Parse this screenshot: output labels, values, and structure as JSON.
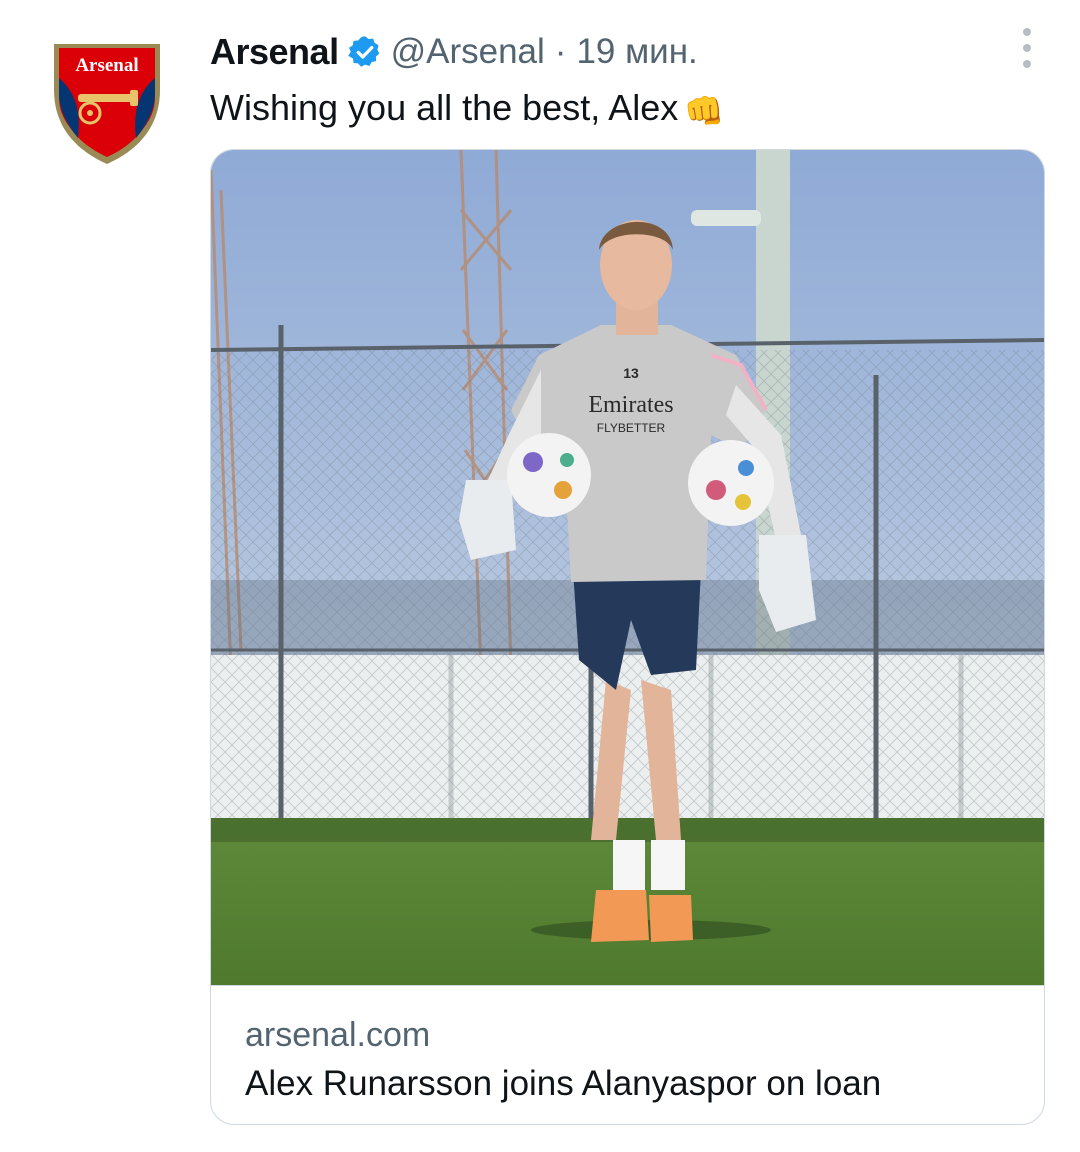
{
  "tweet": {
    "author": {
      "display_name": "Arsenal",
      "handle": "@Arsenal",
      "verified": true,
      "avatar_icon": "arsenal-crest-icon",
      "avatar_text": "Arsenal"
    },
    "separator": "·",
    "timestamp": "19 мин.",
    "text": "Wishing you all the best, Alex",
    "emoji": "👊",
    "more_icon": "more-vertical-icon"
  },
  "link_card": {
    "domain": "arsenal.com",
    "title": "Alex Runarsson joins Alanyaspor on loan",
    "image": {
      "description_icon": "player-photo",
      "shirt_sponsor": "Emirates",
      "shirt_tagline": "FLYBETTER",
      "shirt_number": "13"
    }
  },
  "colors": {
    "verified_blue": "#1d9bf0",
    "text_primary": "#0f1419",
    "text_secondary": "#536471",
    "border": "#cfd9de",
    "arsenal_red": "#db0007",
    "arsenal_navy": "#063672"
  }
}
